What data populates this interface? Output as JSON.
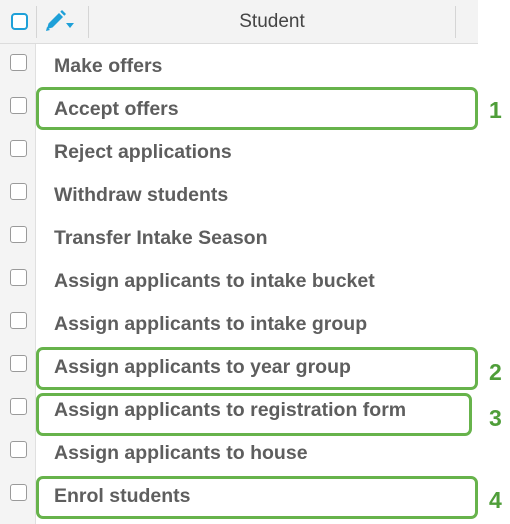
{
  "header": {
    "column_title": "Student",
    "edit_icon": "pencil-dropdown-icon",
    "select_all_icon": "checkbox-icon"
  },
  "menu": {
    "items": [
      {
        "label": "Make offers"
      },
      {
        "label": "Accept offers"
      },
      {
        "label": "Reject applications"
      },
      {
        "label": "Withdraw students"
      },
      {
        "label": "Transfer Intake Season"
      },
      {
        "label": "Assign applicants to intake bucket"
      },
      {
        "label": "Assign applicants to intake group"
      },
      {
        "label": "Assign applicants to year group"
      },
      {
        "label": "Assign applicants to registration form"
      },
      {
        "label": "Assign applicants to house"
      },
      {
        "label": "Enrol students"
      }
    ]
  },
  "annotations": {
    "color": "#67b34b",
    "markers": [
      {
        "number": "1",
        "target": "Accept offers"
      },
      {
        "number": "2",
        "target": "Assign applicants to year group"
      },
      {
        "number": "3",
        "target": "Assign applicants to registration form"
      },
      {
        "number": "4",
        "target": "Enrol students"
      }
    ]
  },
  "colors": {
    "accent": "#1ea0d8",
    "menu_text": "#5e5e5e",
    "header_bg": "#f3f3f3"
  }
}
